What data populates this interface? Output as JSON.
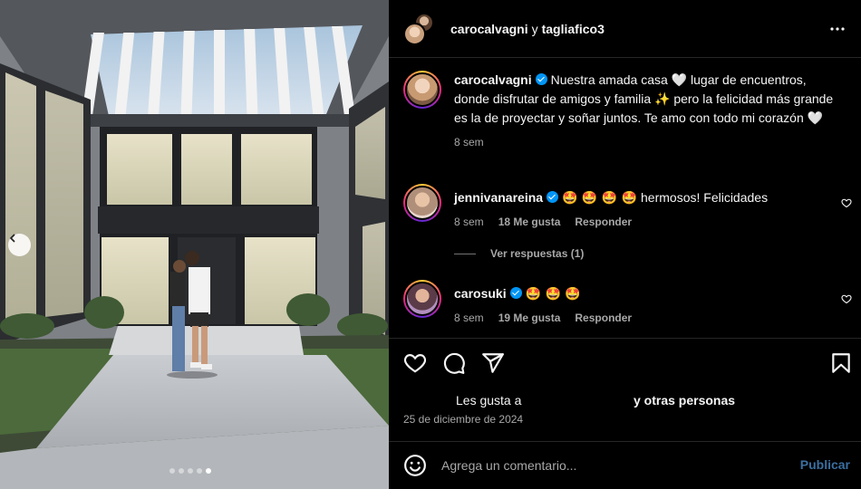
{
  "post": {
    "header": {
      "author_primary": "carocalvagni",
      "conjunction": "y",
      "author_secondary": "tagliafico3",
      "more_icon": "more-horizontal-icon"
    },
    "carousel": {
      "total_slides": 5,
      "active_slide": 5,
      "prev_icon": "chevron-left-icon"
    },
    "caption": {
      "username": "carocalvagni",
      "verified": true,
      "line1": "Nuestra amada casa ",
      "heart1": "🤍",
      "line2": " lugar de encuentros, donde disfrutar de amigos y familia ",
      "sparkles": "✨",
      "line3": "  pero la felicidad más grande es la de proyectar y soñar juntos. Te amo con todo mi corazón ",
      "heart2": "🤍",
      "time": "8 sem"
    },
    "comments": [
      {
        "username": "jennivanareina",
        "verified": true,
        "emojis": "🤩 🤩 🤩 🤩",
        "text": " hermosos! Felicidades",
        "time": "8 sem",
        "likes": "18 Me gusta",
        "reply": "Responder",
        "view_replies": "Ver respuestas (1)"
      },
      {
        "username": "carosuki",
        "verified": true,
        "emojis": "🤩 🤩 🤩",
        "text": "",
        "time": "8 sem",
        "likes": "19 Me gusta",
        "reply": "Responder"
      }
    ],
    "actions": {
      "like_icon": "heart-icon",
      "comment_icon": "comment-icon",
      "share_icon": "send-icon",
      "save_icon": "bookmark-icon"
    },
    "likes_prefix": "Les gusta a",
    "likes_suffix": "y otras personas",
    "date": "25 de diciembre de 2024",
    "comment_input": {
      "placeholder": "Agrega un comentario...",
      "emoji_icon": "smiley-icon",
      "post_label": "Publicar"
    },
    "colors": {
      "background": "#000000",
      "text": "#f5f5f5",
      "secondary_text": "#a8a8a8",
      "verified_blue": "#0095f6",
      "post_button_disabled": "#3b6fa0"
    }
  }
}
